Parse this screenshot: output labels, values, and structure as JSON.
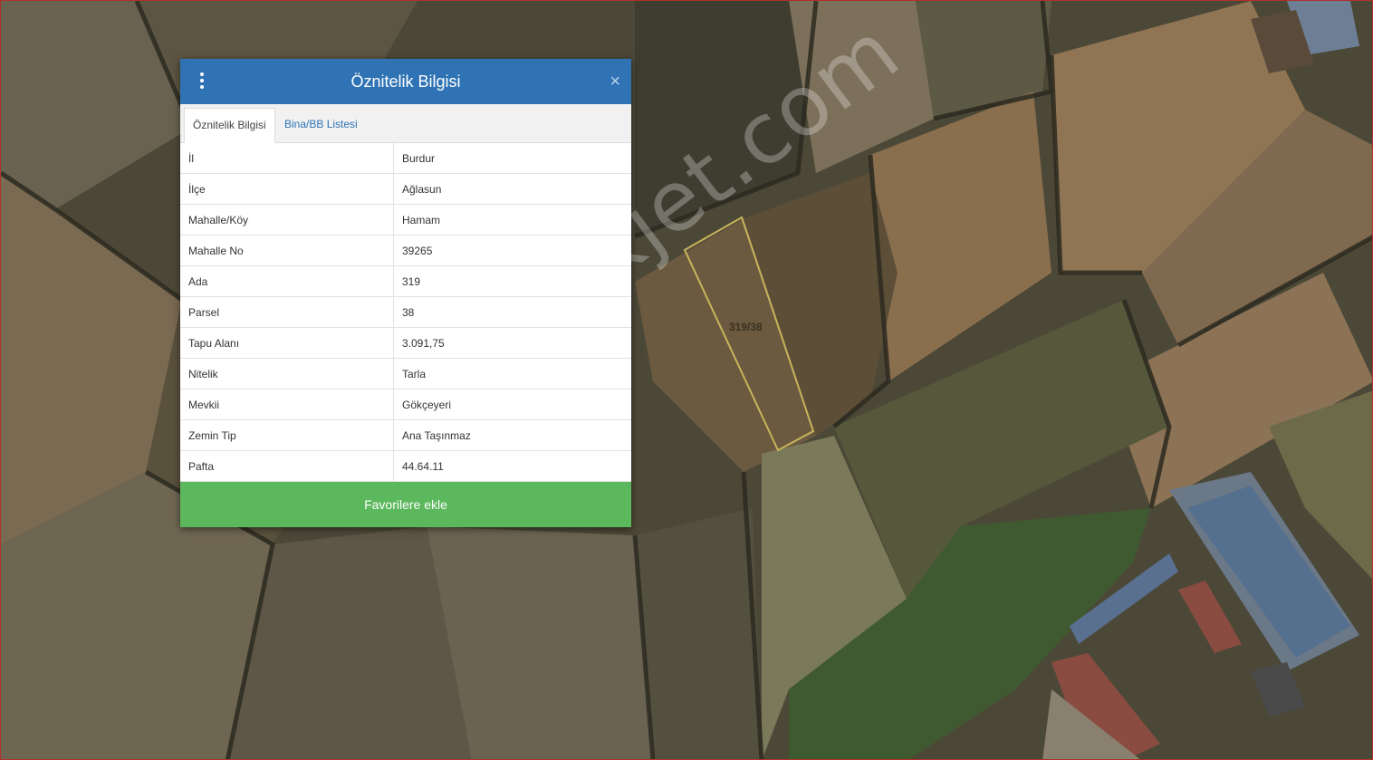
{
  "panel": {
    "title": "Öznitelik Bilgisi",
    "close_icon": "×",
    "menu_icon": "vertical-dots-icon",
    "tabs": [
      {
        "label": "Öznitelik Bilgisi",
        "active": true
      },
      {
        "label": "Bina/BB Listesi",
        "active": false
      }
    ],
    "rows": [
      {
        "key": "İl",
        "value": "Burdur"
      },
      {
        "key": "İlçe",
        "value": "Ağlasun"
      },
      {
        "key": "Mahalle/Köy",
        "value": "Hamam"
      },
      {
        "key": "Mahalle No",
        "value": "39265"
      },
      {
        "key": "Ada",
        "value": "319"
      },
      {
        "key": "Parsel",
        "value": "38"
      },
      {
        "key": "Tapu Alanı",
        "value": "3.091,75"
      },
      {
        "key": "Nitelik",
        "value": "Tarla"
      },
      {
        "key": "Mevkii",
        "value": "Gökçeyeri"
      },
      {
        "key": "Zemin Tip",
        "value": "Ana Taşınmaz"
      },
      {
        "key": "Pafta",
        "value": "44.64.11"
      }
    ],
    "favorite_button": "Favorilere ekle"
  },
  "map": {
    "parcel_label": "319/38",
    "watermark": "emlakjet.com"
  },
  "colors": {
    "header": "#2f73b5",
    "button": "#5cb85c",
    "parcel_outline": "#c8b45a"
  }
}
